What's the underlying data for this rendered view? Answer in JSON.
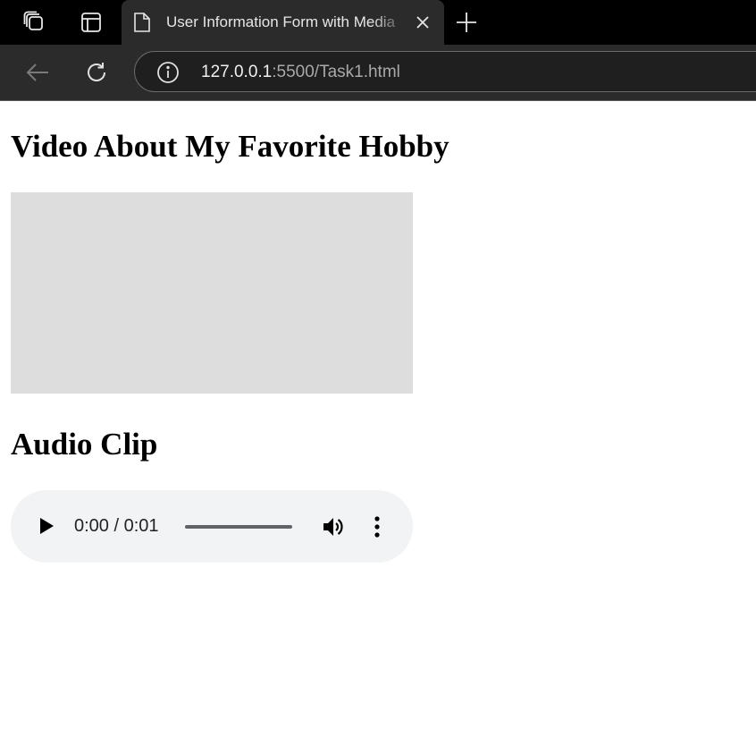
{
  "browser": {
    "tab": {
      "title": "User Information Form with Media"
    },
    "address": {
      "host": "127.0.0.1",
      "rest": ":5500/Task1.html"
    },
    "icons": {
      "workspaces": "workspaces-icon",
      "tab_actions": "tab-actions-icon",
      "page": "page-icon",
      "close": "close-icon",
      "new_tab": "plus-icon",
      "back": "back-arrow-icon",
      "refresh": "refresh-icon",
      "info": "info-icon"
    }
  },
  "main": {
    "video_heading": "Video About My Favorite Hobby",
    "audio_heading": "Audio Clip",
    "audio_player": {
      "time_display": "0:00 / 0:01",
      "progress": 0
    }
  },
  "colors": {
    "tabstrip_bg": "#000000",
    "toolbar_bg": "#2b2b2b",
    "video_placeholder": "#dddddd",
    "audio_player_bg": "#f1f3f4"
  }
}
